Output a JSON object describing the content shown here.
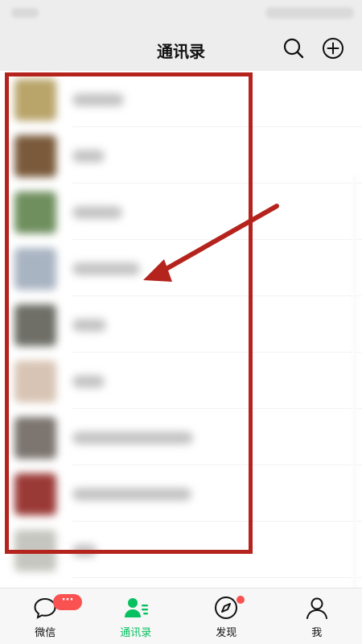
{
  "nav": {
    "title": "通讯录",
    "icons": [
      "search-icon",
      "add-circle-icon"
    ]
  },
  "contacts": [
    {
      "avatar_color": "#b9a46a",
      "name_width": 64
    },
    {
      "avatar_color": "#7a5a3a",
      "name_width": 40
    },
    {
      "avatar_color": "#6f8f5e",
      "name_width": 62
    },
    {
      "avatar_color": "#a9b4c2",
      "name_width": 84
    },
    {
      "avatar_color": "#6f6f68",
      "name_width": 42
    },
    {
      "avatar_color": "#d8c4b4",
      "name_width": 40
    },
    {
      "avatar_color": "#7c7570",
      "name_width": 150
    },
    {
      "avatar_color": "#9a3a36",
      "name_width": 148
    },
    {
      "avatar_color": "#c6c6c0",
      "name_width": 30
    }
  ],
  "tabs": [
    {
      "label": "微信",
      "icon": "chat-icon",
      "active": false,
      "badge": "···"
    },
    {
      "label": "通讯录",
      "icon": "contacts-icon",
      "active": true
    },
    {
      "label": "发现",
      "icon": "compass-icon",
      "active": false,
      "dot": true
    },
    {
      "label": "我",
      "icon": "person-icon",
      "active": false
    }
  ],
  "colors": {
    "accent": "#07c160",
    "annotation": "#b5231d",
    "badge": "#fa5151",
    "nav_background": "#ededed"
  }
}
